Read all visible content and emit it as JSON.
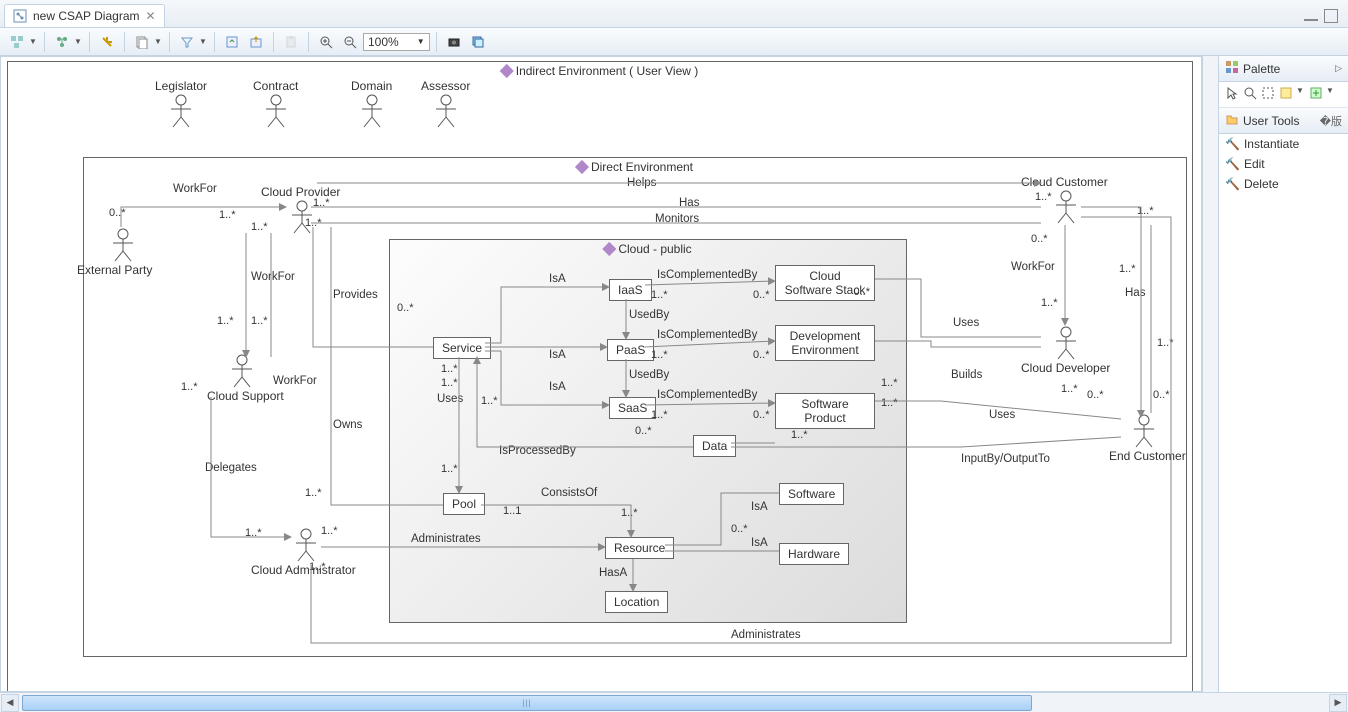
{
  "tab": {
    "title": "new CSAP Diagram"
  },
  "toolbar": {
    "zoom": "100%"
  },
  "palette": {
    "title": "Palette",
    "usertools": "User Tools",
    "items": [
      "Instantiate",
      "Edit",
      "Delete"
    ]
  },
  "diagram": {
    "indirect": "Indirect Environment ( User View )",
    "direct": "Direct Environment",
    "cloud": "Cloud - public",
    "actors_top": [
      "Legislator",
      "Contract",
      "Domain",
      "Assessor"
    ],
    "actors": {
      "external": "External Party",
      "provider": "Cloud Provider",
      "support": "Cloud Support",
      "admin": "Cloud Administrator",
      "customer": "Cloud Customer",
      "developer": "Cloud Developer",
      "endcust": "End Customer"
    },
    "nodes": {
      "service": "Service",
      "iaas": "IaaS",
      "paas": "PaaS",
      "saas": "SaaS",
      "css": "Cloud Software Stack",
      "devenv": "Development Environment",
      "swprod": "Software Product",
      "data": "Data",
      "pool": "Pool",
      "resource": "Resource",
      "location": "Location",
      "software": "Software",
      "hardware": "Hardware"
    },
    "labels": {
      "workfor": "WorkFor",
      "helps": "Helps",
      "has": "Has",
      "monitors": "Monitors",
      "provides": "Provides",
      "owns": "Owns",
      "delegates": "Delegates",
      "uses": "Uses",
      "isa": "IsA",
      "usedby": "UsedBy",
      "iscomp": "IsComplementedBy",
      "builds": "Builds",
      "isproc": "IsProcessedBy",
      "consists": "ConsistsOf",
      "administrates": "Administrates",
      "hasa": "HasA",
      "inout": "InputBy/OutputTo"
    },
    "mult": {
      "zm": "0..*",
      "om": "1..*",
      "oo": "1..1"
    }
  }
}
